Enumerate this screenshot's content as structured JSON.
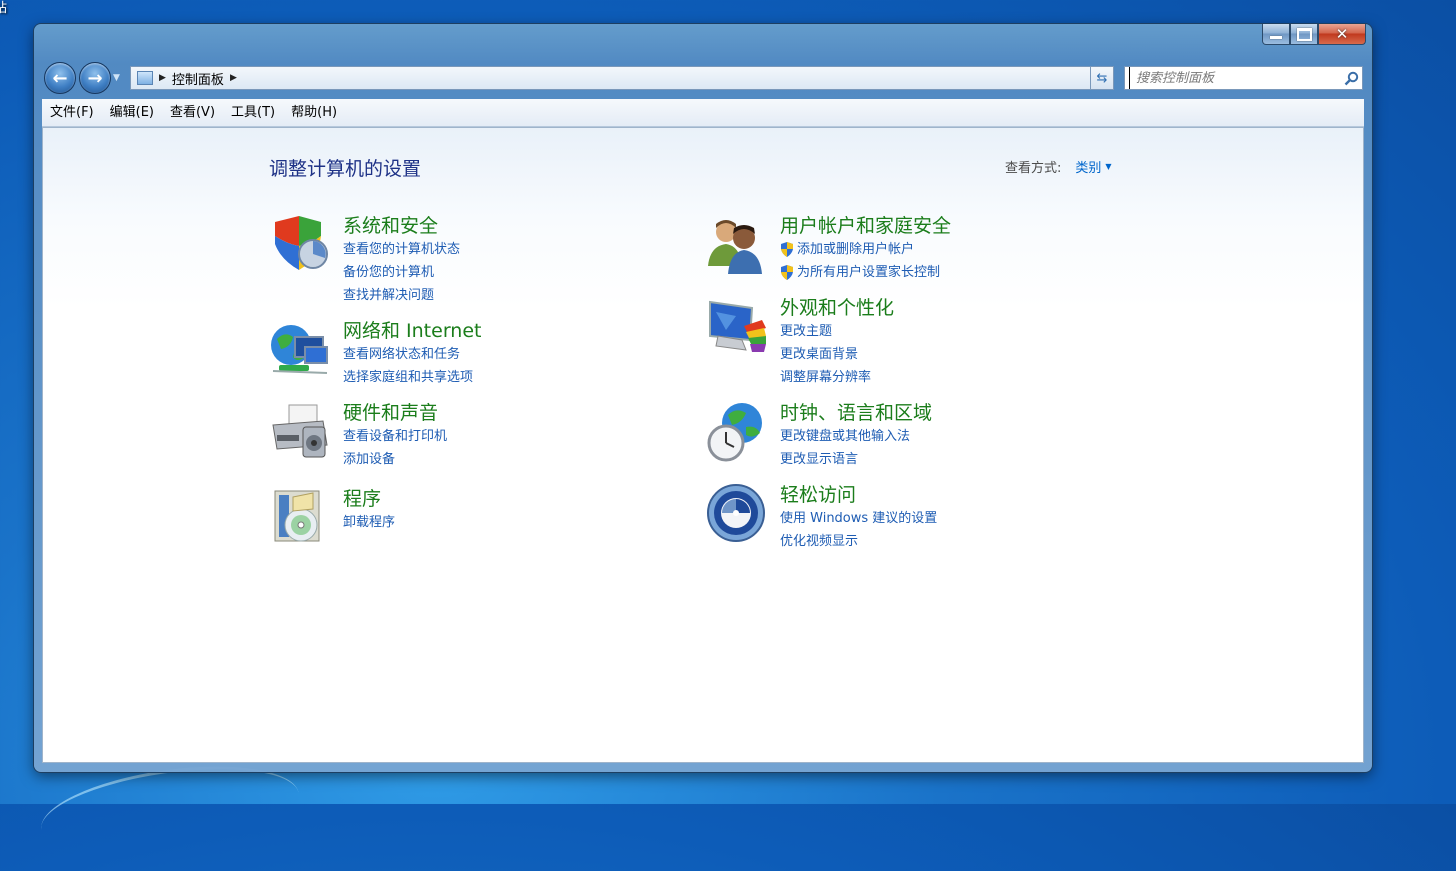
{
  "desktop": {
    "label": "站"
  },
  "window": {
    "caption": {
      "close": "✕"
    },
    "nav": {
      "back": "←",
      "forward": "→"
    },
    "address": {
      "path": "控制面板"
    },
    "search": {
      "placeholder": "搜索控制面板"
    },
    "menu": [
      "文件(F)",
      "编辑(E)",
      "查看(V)",
      "工具(T)",
      "帮助(H)"
    ]
  },
  "page": {
    "title": "调整计算机的设置",
    "view_by_label": "查看方式:",
    "view_by_value": "类别"
  },
  "categories": [
    {
      "title": "系统和安全",
      "icon": "security-shield-icon",
      "links": [
        "查看您的计算机状态",
        "备份您的计算机",
        "查找并解决问题"
      ]
    },
    {
      "title": "网络和 Internet",
      "icon": "network-globe-icon",
      "links": [
        "查看网络状态和任务",
        "选择家庭组和共享选项"
      ]
    },
    {
      "title": "硬件和声音",
      "icon": "printer-icon",
      "links": [
        "查看设备和打印机",
        "添加设备"
      ]
    },
    {
      "title": "程序",
      "icon": "programs-disc-icon",
      "links": [
        "卸载程序"
      ]
    },
    {
      "title": "用户帐户和家庭安全",
      "icon": "users-icon",
      "links": [
        "添加或删除用户帐户",
        "为所有用户设置家长控制"
      ]
    },
    {
      "title": "外观和个性化",
      "icon": "monitor-palette-icon",
      "links": [
        "更改主题",
        "更改桌面背景",
        "调整屏幕分辨率"
      ]
    },
    {
      "title": "时钟、语言和区域",
      "icon": "clock-globe-icon",
      "links": [
        "更改键盘或其他输入法",
        "更改显示语言"
      ]
    },
    {
      "title": "轻松访问",
      "icon": "ease-of-access-icon",
      "links": [
        "使用 Windows 建议的设置",
        "优化视频显示"
      ]
    }
  ],
  "colors": {
    "category_title": "#1b7d1b",
    "link": "#1e5cb3",
    "page_title": "#1e3287"
  }
}
